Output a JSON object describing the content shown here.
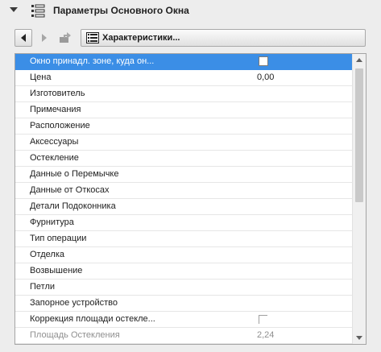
{
  "header": {
    "title": "Параметры Основного Окна",
    "collapse_icon": "triangle-down-icon",
    "panel_icon": "window-grid-icon"
  },
  "toolbar": {
    "back_icon": "arrow-left-icon",
    "forward_icon": "arrow-right-icon",
    "export_icon": "export-icon",
    "dropdown_icon": "grid-panel-icon",
    "dropdown_label": "Характеристики..."
  },
  "properties": {
    "selected_color": "#3b8ee6",
    "rows": [
      {
        "name": "Окно принадл. зоне, куда он...",
        "type": "checkbox",
        "value": "",
        "state": "selected"
      },
      {
        "name": "Цена",
        "type": "text",
        "value": "0,00",
        "state": "normal"
      },
      {
        "name": "Изготовитель",
        "type": "text",
        "value": "",
        "state": "normal"
      },
      {
        "name": "Примечания",
        "type": "text",
        "value": "",
        "state": "normal"
      },
      {
        "name": "Расположение",
        "type": "text",
        "value": "",
        "state": "normal"
      },
      {
        "name": "Аксессуары",
        "type": "text",
        "value": "",
        "state": "normal"
      },
      {
        "name": "Остекление",
        "type": "text",
        "value": "",
        "state": "normal"
      },
      {
        "name": "Данные о Перемычке",
        "type": "text",
        "value": "",
        "state": "normal"
      },
      {
        "name": "Данные от Откосах",
        "type": "text",
        "value": "",
        "state": "normal"
      },
      {
        "name": "Детали Подоконника",
        "type": "text",
        "value": "",
        "state": "normal"
      },
      {
        "name": "Фурнитура",
        "type": "text",
        "value": "",
        "state": "normal"
      },
      {
        "name": "Тип операции",
        "type": "text",
        "value": "",
        "state": "normal"
      },
      {
        "name": "Отделка",
        "type": "text",
        "value": "",
        "state": "normal"
      },
      {
        "name": "Возвышение",
        "type": "text",
        "value": "",
        "state": "normal"
      },
      {
        "name": "Петли",
        "type": "text",
        "value": "",
        "state": "normal"
      },
      {
        "name": "Запорное устройство",
        "type": "text",
        "value": "",
        "state": "normal"
      },
      {
        "name": "Коррекция площади остекле...",
        "type": "checkbox-disabled",
        "value": "",
        "state": "normal"
      },
      {
        "name": "Площадь Остекления",
        "type": "text",
        "value": "2,24",
        "state": "disabled"
      }
    ]
  }
}
